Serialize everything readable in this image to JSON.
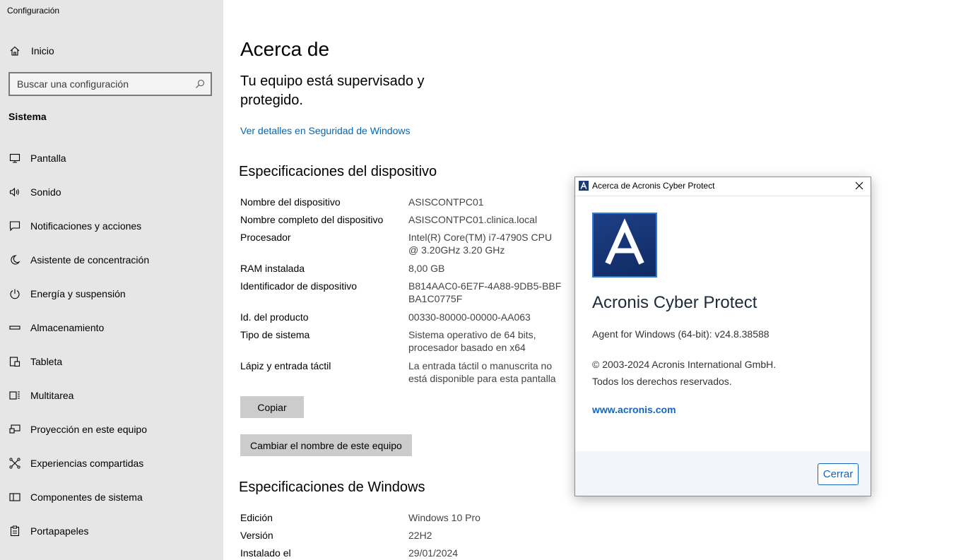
{
  "app": {
    "title": "Configuración"
  },
  "sidebar": {
    "home": {
      "label": "Inicio",
      "icon": "home-icon"
    },
    "search": {
      "placeholder": "Buscar una configuración"
    },
    "section_title": "Sistema",
    "items": [
      {
        "label": "Pantalla",
        "icon": "display-icon"
      },
      {
        "label": "Sonido",
        "icon": "speaker-icon"
      },
      {
        "label": "Notificaciones y acciones",
        "icon": "notification-icon"
      },
      {
        "label": "Asistente de concentración",
        "icon": "moon-icon"
      },
      {
        "label": "Energía y suspensión",
        "icon": "power-icon"
      },
      {
        "label": "Almacenamiento",
        "icon": "storage-icon"
      },
      {
        "label": "Tableta",
        "icon": "tablet-icon"
      },
      {
        "label": "Multitarea",
        "icon": "multitask-icon"
      },
      {
        "label": "Proyección en este equipo",
        "icon": "projection-icon"
      },
      {
        "label": "Experiencias compartidas",
        "icon": "shared-icon"
      },
      {
        "label": "Componentes de sistema",
        "icon": "components-icon"
      },
      {
        "label": "Portapapeles",
        "icon": "clipboard-icon"
      }
    ]
  },
  "main": {
    "title": "Acerca de",
    "protection_text": "Tu equipo está supervisado y protegido.",
    "security_link": "Ver detalles en Seguridad de Windows",
    "device_specs": {
      "heading": "Especificaciones del dispositivo",
      "rows": [
        {
          "key": "Nombre del dispositivo",
          "value": "ASISCONTPC01"
        },
        {
          "key": "Nombre completo del dispositivo",
          "value": "ASISCONTPC01.clinica.local"
        },
        {
          "key": "Procesador",
          "value": "Intel(R) Core(TM) i7-4790S CPU @ 3.20GHz   3.20 GHz"
        },
        {
          "key": "RAM instalada",
          "value": "8,00 GB"
        },
        {
          "key": "Identificador de dispositivo",
          "value": "B814AAC0-6E7F-4A88-9DB5-BBFBA1C0775F"
        },
        {
          "key": "Id. del producto",
          "value": "00330-80000-00000-AA063"
        },
        {
          "key": "Tipo de sistema",
          "value": "Sistema operativo de 64 bits, procesador basado en x64"
        },
        {
          "key": "Lápiz y entrada táctil",
          "value": "La entrada táctil o manuscrita no está disponible para esta pantalla"
        }
      ],
      "copy_button": "Copiar",
      "rename_button": "Cambiar el nombre de este equipo"
    },
    "windows_specs": {
      "heading": "Especificaciones de Windows",
      "rows": [
        {
          "key": "Edición",
          "value": "Windows 10 Pro"
        },
        {
          "key": "Versión",
          "value": "22H2"
        },
        {
          "key": "Instalado el",
          "value": "29/01/2024"
        }
      ]
    }
  },
  "dialog": {
    "title": "Acerca de Acronis Cyber Protect",
    "logo_letter": "A",
    "product_name": "Acronis Cyber Protect",
    "version": "Agent for Windows (64-bit): v24.8.38588",
    "copyright_line1": "© 2003-2024 Acronis International GmbH.",
    "copyright_line2": "Todos los derechos reservados.",
    "link": "www.acronis.com",
    "close_button": "Cerrar"
  },
  "colors": {
    "sidebar_bg": "#e6e6e6",
    "link": "#0067b8",
    "button_gray": "#cccccc",
    "acronis_blue": "#1e3f86",
    "acronis_accent": "#1565c0"
  }
}
